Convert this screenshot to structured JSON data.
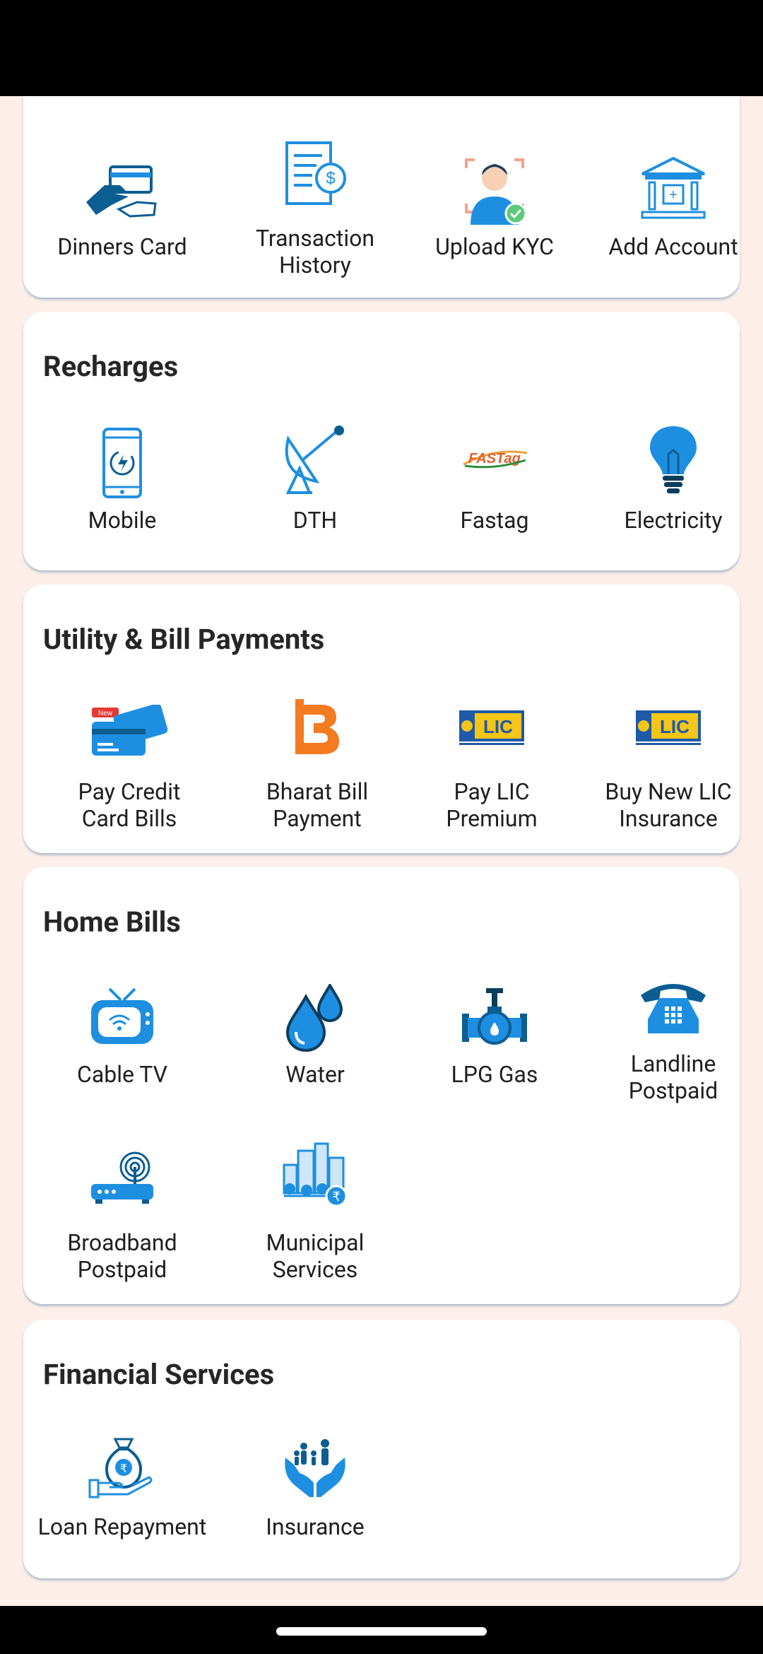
{
  "top_card": {
    "items": [
      {
        "label": "Dinners Card",
        "icon": "card-hand-icon"
      },
      {
        "label": "Transaction History",
        "icon": "receipt-icon"
      },
      {
        "label": "Upload KYC",
        "icon": "kyc-person-icon"
      },
      {
        "label": "Add Account",
        "icon": "bank-icon"
      }
    ]
  },
  "recharges": {
    "title": "Recharges",
    "items": [
      {
        "label": "Mobile",
        "icon": "mobile-icon"
      },
      {
        "label": "DTH",
        "icon": "satellite-dish-icon"
      },
      {
        "label": "Fastag",
        "icon": "fastag-logo-icon"
      },
      {
        "label": "Electricity",
        "icon": "bulb-icon"
      }
    ]
  },
  "utility": {
    "title": "Utility & Bill Payments",
    "items": [
      {
        "label": "Pay Credit Card Bills",
        "icon": "credit-card-icon",
        "badge": "New"
      },
      {
        "label": "Bharat Bill Payment",
        "icon": "bharat-bill-logo-icon"
      },
      {
        "label": "Pay LIC Premium",
        "icon": "lic-logo-icon"
      },
      {
        "label": "Buy New LIC Insurance",
        "icon": "lic-logo-icon"
      }
    ]
  },
  "home_bills": {
    "title": "Home Bills",
    "items": [
      {
        "label": "Cable TV",
        "icon": "tv-icon"
      },
      {
        "label": "Water",
        "icon": "water-drops-icon"
      },
      {
        "label": "LPG Gas",
        "icon": "gas-pipe-icon"
      },
      {
        "label": "Landline Postpaid",
        "icon": "telephone-icon"
      },
      {
        "label": "Broadband Postpaid",
        "icon": "router-icon"
      },
      {
        "label": "Municipal Services",
        "icon": "city-icon"
      }
    ]
  },
  "financial": {
    "title": "Financial Services",
    "items": [
      {
        "label": "Loan Repayment",
        "icon": "money-bag-hand-icon"
      },
      {
        "label": "Insurance",
        "icon": "family-hands-icon"
      }
    ]
  },
  "colors": {
    "accent": "#1e8fe0",
    "dark_accent": "#0b5d92",
    "background": "#fcefe9"
  }
}
